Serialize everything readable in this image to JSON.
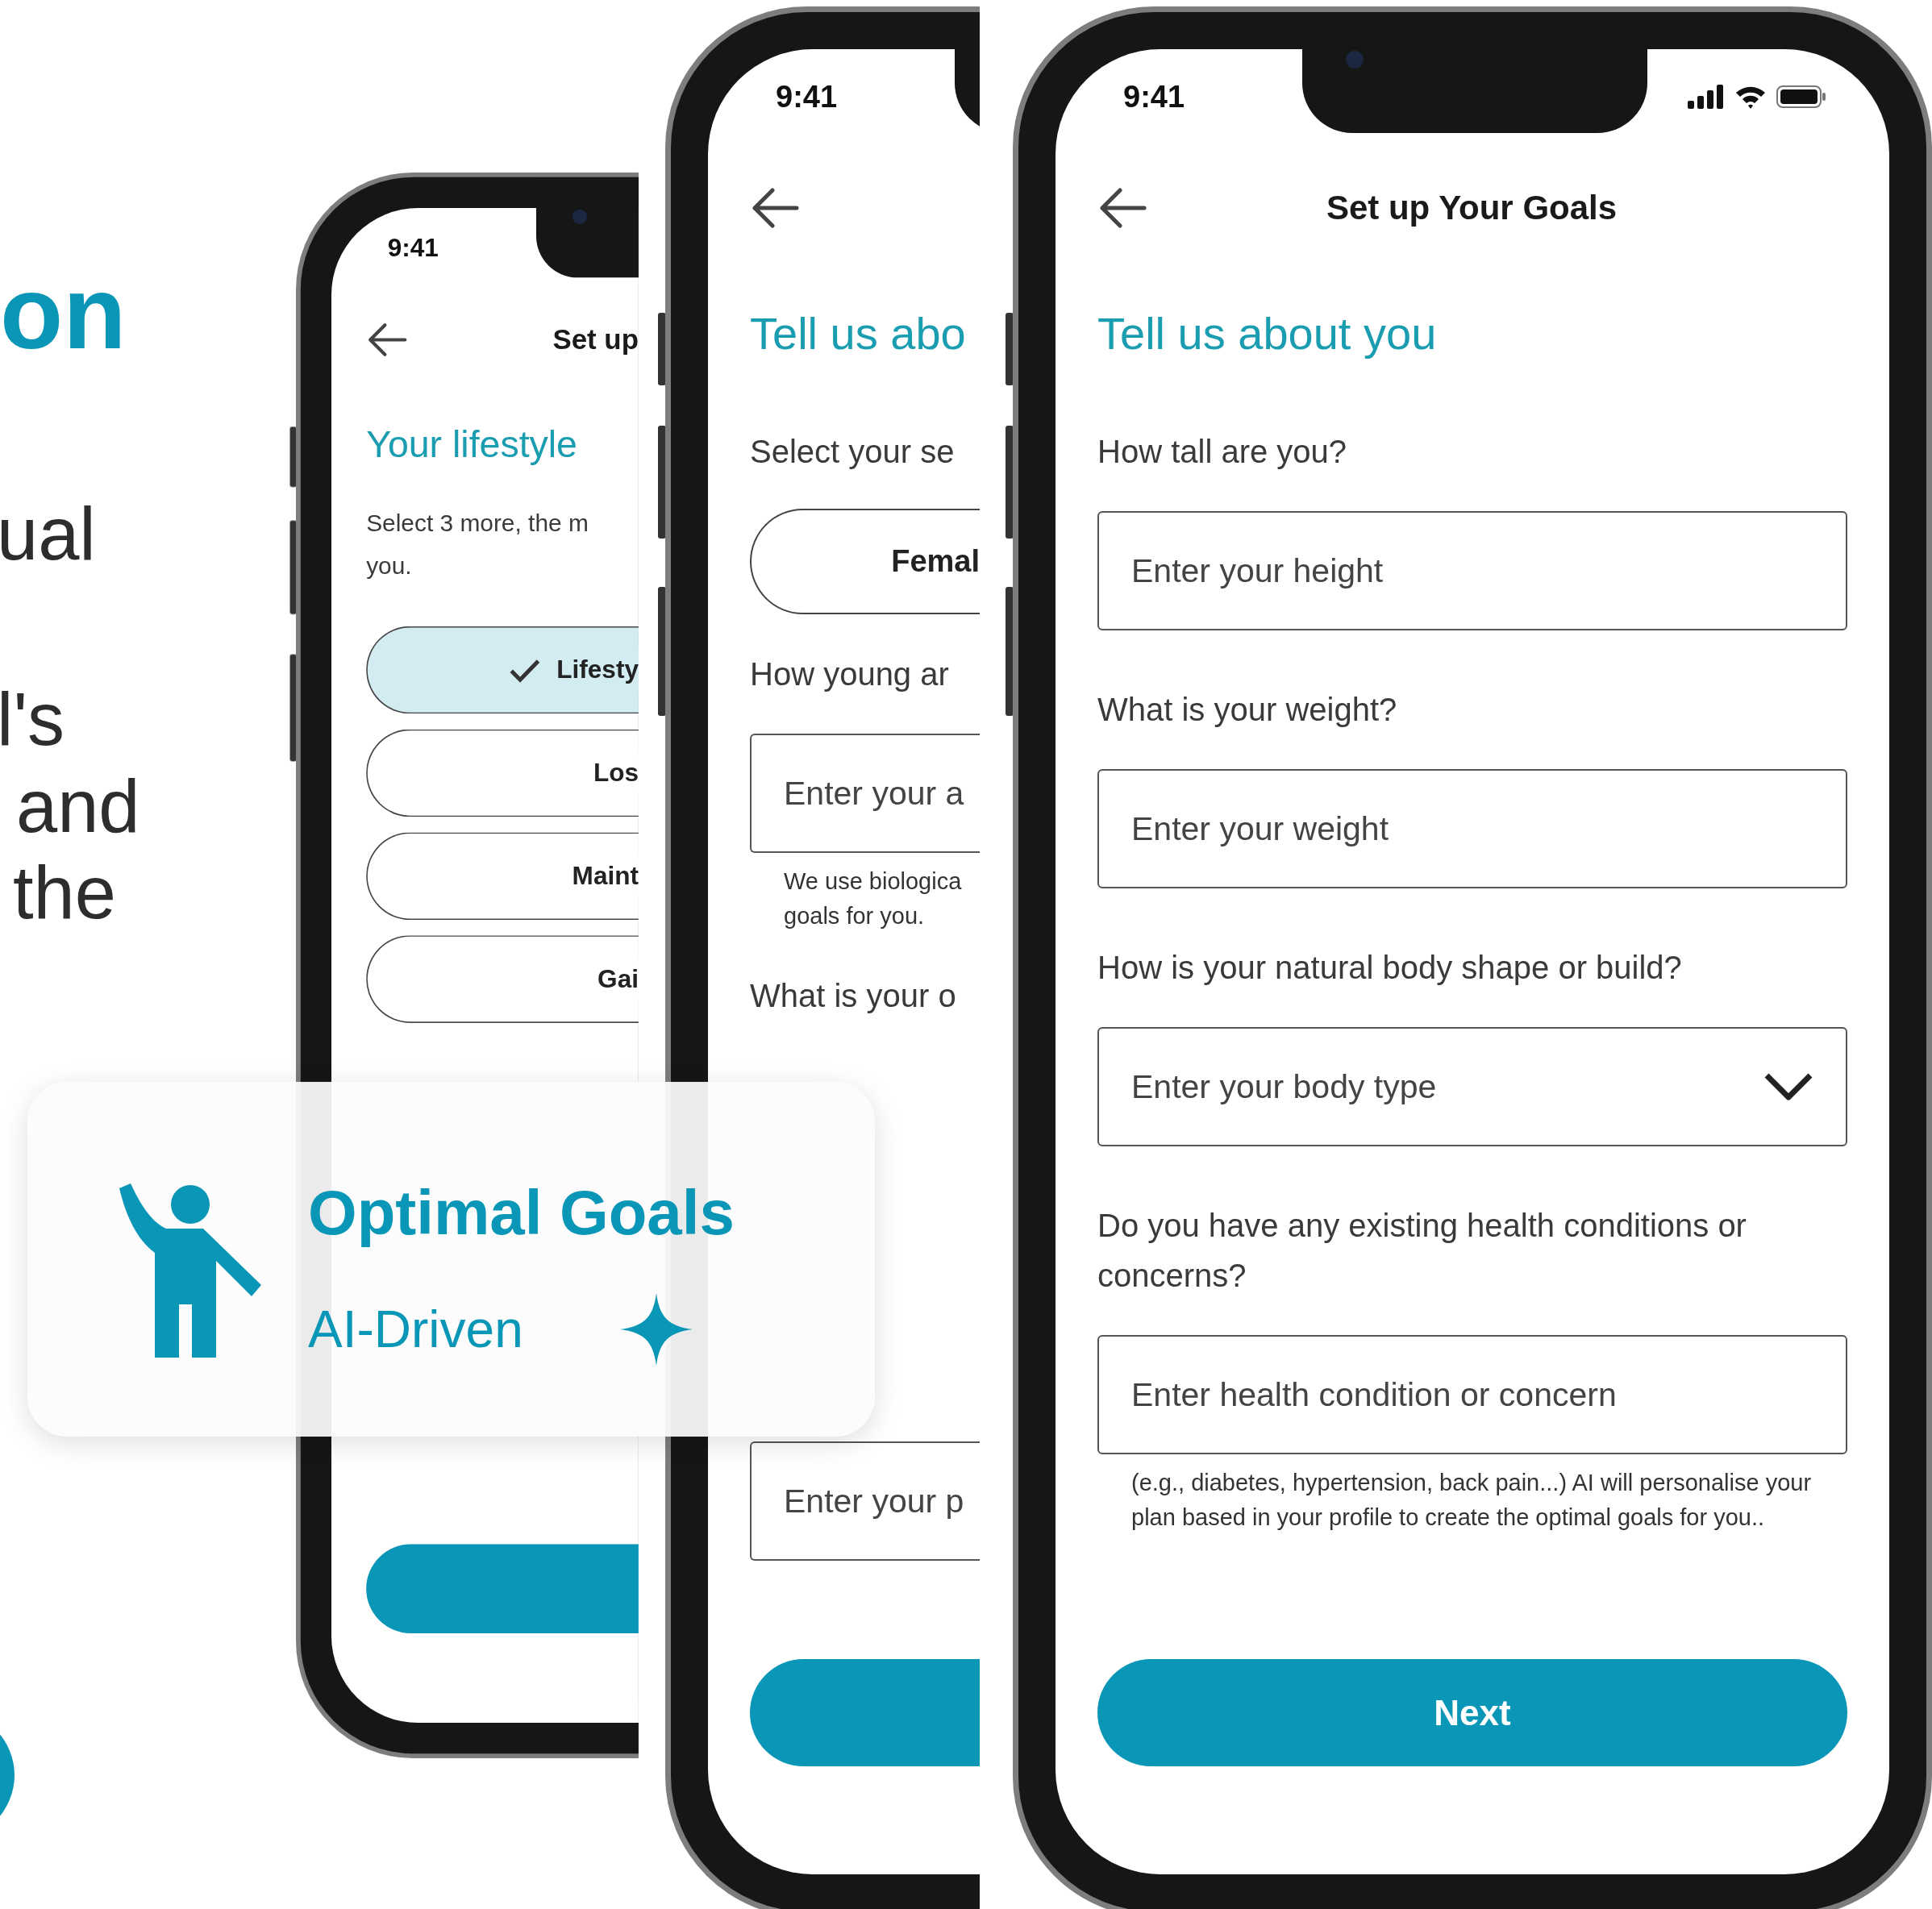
{
  "intro": {
    "title": "on",
    "lines": [
      "ual",
      "l's",
      "and",
      "the"
    ]
  },
  "phones": [
    {
      "time": "9:41",
      "title": "Set up",
      "heading": "Your lifestyle",
      "items": [
        {
          "kind": "prompt",
          "text": "Select 3 more, the m\nyou."
        },
        {
          "kind": "choice",
          "label": "Lifesty",
          "selected": true
        },
        {
          "kind": "choice",
          "label": "Los",
          "selected": false
        },
        {
          "kind": "choice",
          "label": "Maint",
          "selected": false
        },
        {
          "kind": "choice",
          "label": "Gai",
          "selected": false
        }
      ]
    },
    {
      "time": "9:41",
      "heading": "Tell us abo",
      "items": [
        {
          "kind": "question",
          "text": "Select your se"
        },
        {
          "kind": "choice",
          "label": "Femal",
          "selected": false
        },
        {
          "kind": "question",
          "text": "How young ar"
        },
        {
          "kind": "field",
          "placeholder": "Enter your a"
        },
        {
          "kind": "note",
          "text": "We use biologica\ngoals for you."
        },
        {
          "kind": "question",
          "text": "What is your o"
        },
        {
          "kind": "field",
          "placeholder": "Enter your p"
        }
      ]
    },
    {
      "time": "9:41",
      "title": "Set up Your Goals",
      "heading": "Tell us about you",
      "items": [
        {
          "kind": "question",
          "text": "How tall are you?"
        },
        {
          "kind": "field",
          "placeholder": "Enter your height"
        },
        {
          "kind": "question",
          "text": "What is your weight?"
        },
        {
          "kind": "field",
          "placeholder": "Enter your weight"
        },
        {
          "kind": "question",
          "text": "How is your natural body shape or build?"
        },
        {
          "kind": "dropdown",
          "placeholder": "Enter your body type"
        },
        {
          "kind": "question",
          "text": "Do you have any existing health conditions or concerns?"
        },
        {
          "kind": "field",
          "placeholder": "Enter health condition or concern"
        },
        {
          "kind": "note",
          "text": "(e.g., diabetes, hypertension, back pain...) AI will personalise your plan based in your profile to create the optimal goals for you.."
        }
      ],
      "button": {
        "label": "Next"
      }
    }
  ],
  "card": {
    "title": "Optimal Goals",
    "subtitle": "AI-Driven"
  }
}
